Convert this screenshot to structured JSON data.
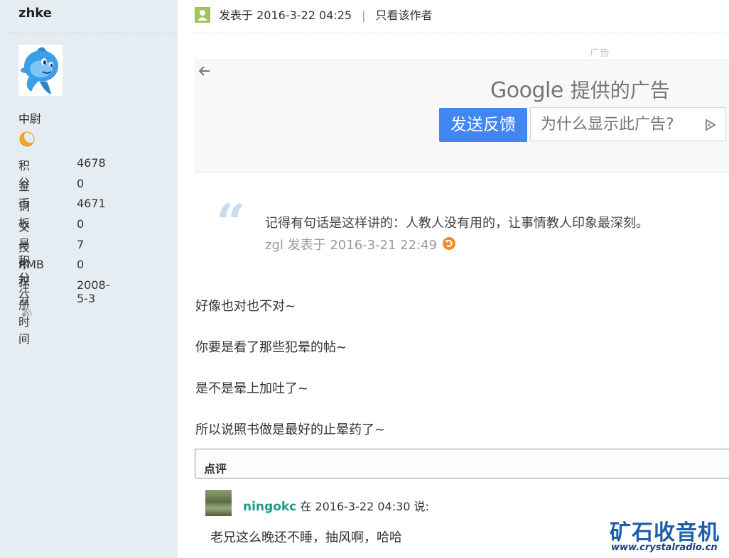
{
  "user": {
    "name": "zhke",
    "rank": "中尉",
    "stats": [
      {
        "label": "积分",
        "value": "4678"
      },
      {
        "label": "金币",
        "value": "0"
      },
      {
        "label": "铜板",
        "value": "4671"
      },
      {
        "label": "交易积分",
        "value": "0"
      },
      {
        "label": "技术积分",
        "value": "7"
      },
      {
        "label": "RMB",
        "value": "0"
      },
      {
        "label": "注册时间",
        "value": "2008-5-3"
      }
    ]
  },
  "post": {
    "posted_label": "发表于 2016-3-22 04:25",
    "separator": "|",
    "author_only": "只看该作者"
  },
  "ad": {
    "label": "广告",
    "google": "Google",
    "provided": "提供的广告",
    "feedback_button": "发送反馈",
    "why_button": "为什么显示此广告?"
  },
  "quote": {
    "mark": "“",
    "text": "记得有句话是这样讲的：人教人没有用的，让事情教人印象最深刻。",
    "by": "zgl 发表于 2016-3-21 22:49"
  },
  "paragraphs": [
    "好像也对也不对~",
    "你要是看了那些犯晕的帖~",
    "是不是晕上加吐了~",
    "所以说照书做是最好的止晕药了~"
  ],
  "comments": {
    "title": "点评",
    "items": [
      {
        "user": "ningokc",
        "meta": " 在 2016-3-22 04:30 说:",
        "text": "老兄这么晚还不睡，抽风啊，哈哈"
      }
    ]
  },
  "watermark": {
    "title": "矿石收音机",
    "url": "www.crystalradio.cn"
  },
  "colors": {
    "sidebar_bg": "#e5edf2",
    "ad_button": "#4285f4",
    "comment_user": "#1e9a8a",
    "quote_mark": "#c7dcef",
    "watermark": "#1d5fa8"
  }
}
